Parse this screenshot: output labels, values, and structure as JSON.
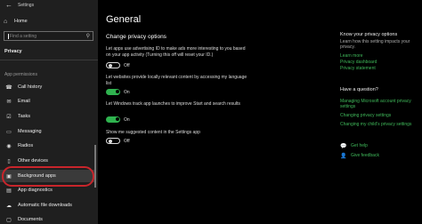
{
  "window": {
    "title": "Settings",
    "back_glyph": "←"
  },
  "sidebar": {
    "home_label": "Home",
    "search_placeholder": "Find a setting",
    "section_title": "Privacy",
    "group_label": "App permissions",
    "items": [
      {
        "label": "Call history",
        "icon": "phone-icon"
      },
      {
        "label": "Email",
        "icon": "mail-icon"
      },
      {
        "label": "Tasks",
        "icon": "tasks-icon"
      },
      {
        "label": "Messaging",
        "icon": "messaging-icon"
      },
      {
        "label": "Radios",
        "icon": "radios-icon"
      },
      {
        "label": "Other devices",
        "icon": "devices-icon"
      },
      {
        "label": "Background apps",
        "icon": "background-apps-icon"
      },
      {
        "label": "App diagnostics",
        "icon": "diagnostics-icon"
      },
      {
        "label": "Automatic file downloads",
        "icon": "download-icon"
      },
      {
        "label": "Documents",
        "icon": "documents-icon"
      }
    ]
  },
  "main": {
    "heading": "General",
    "subheading": "Change privacy options",
    "options": [
      {
        "desc": "Let apps use advertising ID to make ads more interesting to you based on your app activity (Turning this off will reset your ID.)",
        "state": "Off"
      },
      {
        "desc": "Let websites provide locally relevant content by accessing my language list",
        "state": "On"
      },
      {
        "desc": "Let Windows track app launches to improve Start and search results",
        "state": "On"
      },
      {
        "desc": "Show me suggested content in the Settings app",
        "state": "Off"
      }
    ]
  },
  "right_panel": {
    "know_title": "Know your privacy options",
    "know_text": "Learn how this setting impacts your privacy.",
    "links": [
      "Learn more",
      "Privacy dashboard",
      "Privacy statement"
    ],
    "question_title": "Have a question?",
    "question_links": [
      "Managing Microsoft account privacy settings",
      "Changing privacy settings",
      "Changing my child's privacy settings"
    ],
    "get_help": "Get help",
    "give_feedback": "Give feedback"
  },
  "colors": {
    "accent": "#2fb34f",
    "link": "#3fb95a",
    "highlight": "#c8252b"
  }
}
